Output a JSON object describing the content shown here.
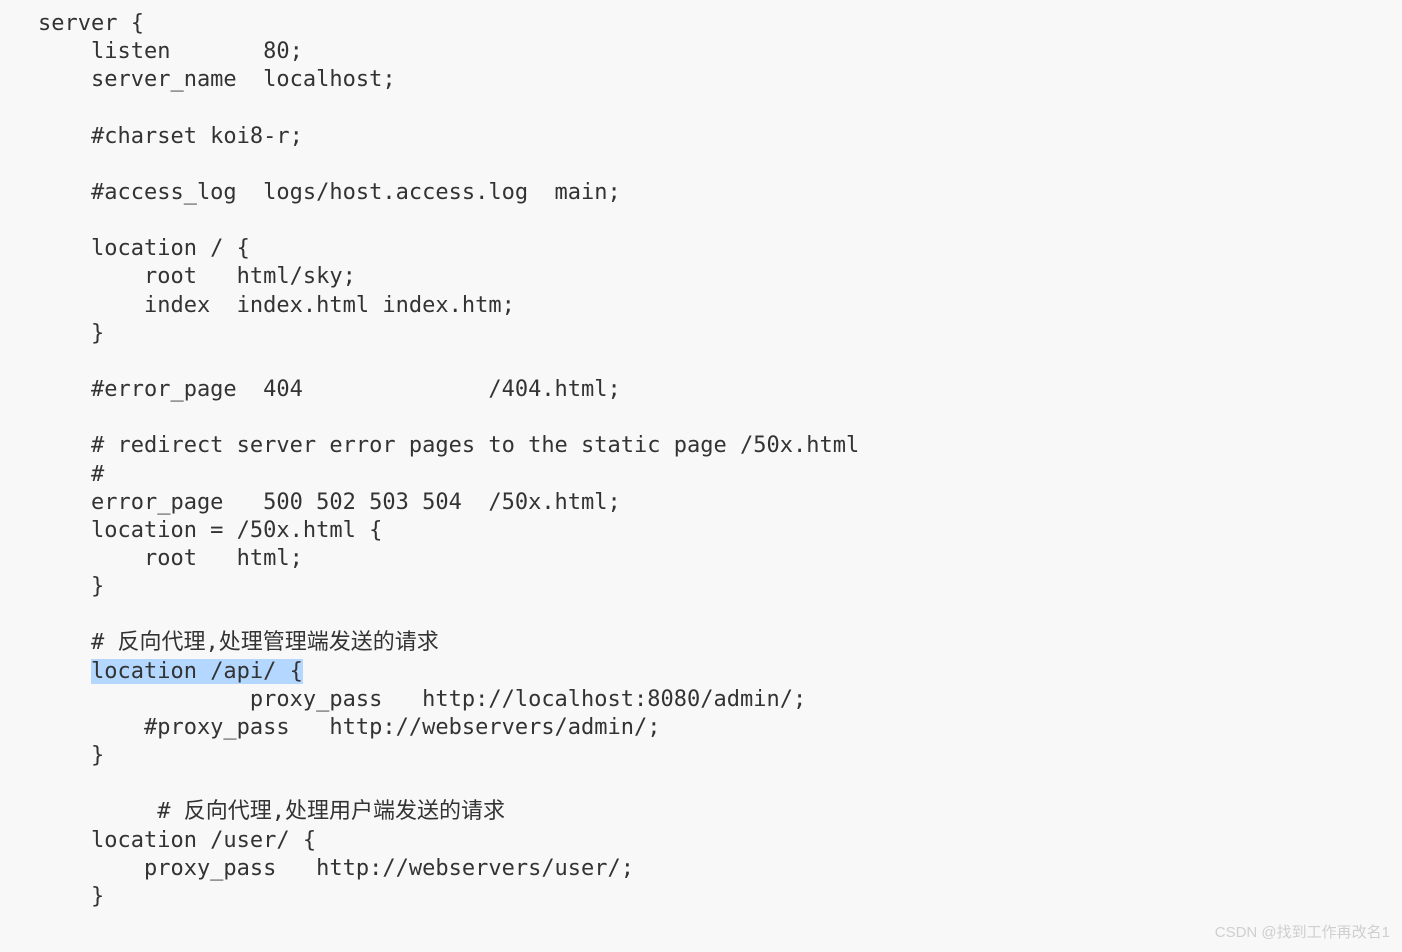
{
  "code": {
    "line01": "server {",
    "line02": "    listen       80;",
    "line03": "    server_name  localhost;",
    "line04": "",
    "line05": "    #charset koi8-r;",
    "line06": "",
    "line07": "    #access_log  logs/host.access.log  main;",
    "line08": "",
    "line09": "    location / {",
    "line10": "        root   html/sky;",
    "line11": "        index  index.html index.htm;",
    "line12": "    }",
    "line13": "",
    "line14": "    #error_page  404              /404.html;",
    "line15": "",
    "line16": "    # redirect server error pages to the static page /50x.html",
    "line17": "    #",
    "line18": "    error_page   500 502 503 504  /50x.html;",
    "line19": "    location = /50x.html {",
    "line20": "        root   html;",
    "line21": "    }",
    "line22": "",
    "line23": "    # 反向代理,处理管理端发送的请求",
    "line24_prefix": "    ",
    "line24_highlight": "location /api/ {",
    "line25": "                proxy_pass   http://localhost:8080/admin/;",
    "line26": "        #proxy_pass   http://webservers/admin/;",
    "line27": "    }",
    "line28": "",
    "line29": "         # 反向代理,处理用户端发送的请求",
    "line30": "    location /user/ {",
    "line31": "        proxy_pass   http://webservers/user/;",
    "line32": "    }"
  },
  "watermark": "CSDN @找到工作再改名1"
}
